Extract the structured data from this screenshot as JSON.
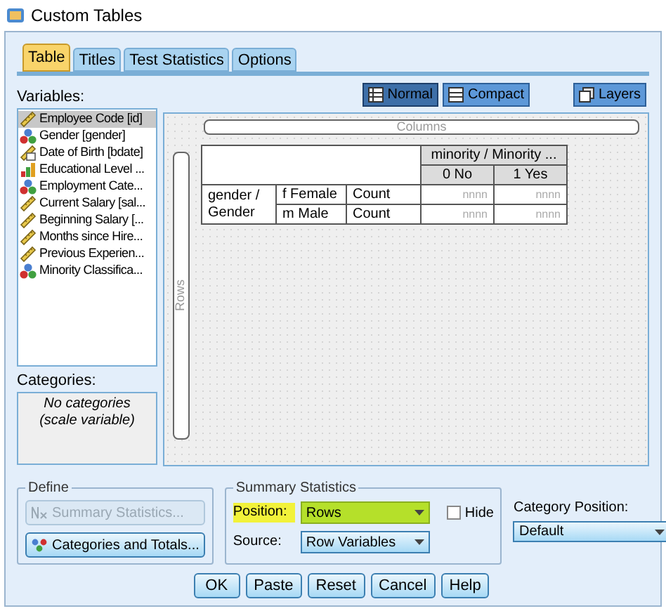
{
  "window": {
    "title": "Custom Tables"
  },
  "tabs": [
    {
      "label": "Table",
      "selected": true
    },
    {
      "label": "Titles",
      "selected": false
    },
    {
      "label": "Test Statistics",
      "selected": false
    },
    {
      "label": "Options",
      "selected": false
    }
  ],
  "view_buttons": [
    {
      "label": "Normal",
      "kind": "normal",
      "selected": true
    },
    {
      "label": "Compact",
      "kind": "compact",
      "selected": false
    }
  ],
  "layers_button": "Layers",
  "variables": {
    "label": "Variables:",
    "items": [
      {
        "name": "Employee Code [id]",
        "kind": "scale",
        "selected": true
      },
      {
        "name": "Gender [gender]",
        "kind": "nominal",
        "selected": false
      },
      {
        "name": "Date of Birth [bdate]",
        "kind": "date",
        "selected": false
      },
      {
        "name": "Educational Level ...",
        "kind": "ordinal",
        "selected": false
      },
      {
        "name": "Employment Cate...",
        "kind": "nominal",
        "selected": false
      },
      {
        "name": "Current Salary [sal...",
        "kind": "scale",
        "selected": false
      },
      {
        "name": "Beginning Salary [...",
        "kind": "scale",
        "selected": false
      },
      {
        "name": "Months since Hire...",
        "kind": "scale",
        "selected": false
      },
      {
        "name": "Previous Experien...",
        "kind": "scale",
        "selected": false
      },
      {
        "name": "Minority Classifica...",
        "kind": "nominal",
        "selected": false
      }
    ]
  },
  "categories": {
    "label": "Categories:",
    "text": "No categories (scale variable)"
  },
  "canvas": {
    "columns_label": "Columns",
    "rows_label": "Rows",
    "table": {
      "column_variable": "minority / Minority ...",
      "column_categories": [
        "0 No",
        "1 Yes"
      ],
      "row_variable": "gender / Gender",
      "rows": [
        {
          "category": "f Female",
          "statistic": "Count",
          "cells": [
            "nnnn",
            "nnnn"
          ]
        },
        {
          "category": "m Male",
          "statistic": "Count",
          "cells": [
            "nnnn",
            "nnnn"
          ]
        }
      ]
    }
  },
  "define": {
    "title": "Define",
    "buttons": [
      {
        "label": "Summary Statistics...",
        "kind": "summary",
        "disabled": true
      },
      {
        "label": "Categories and Totals...",
        "kind": "categories",
        "disabled": false
      }
    ]
  },
  "summary_statistics": {
    "title": "Summary Statistics",
    "fields": [
      {
        "label": "Position:",
        "value": "Rows",
        "highlighted": true
      },
      {
        "label": "Source:",
        "value": "Row Variables",
        "highlighted": false
      }
    ],
    "hide": {
      "label": "Hide",
      "checked": false
    }
  },
  "category_position": {
    "label": "Category Position:",
    "value": "Default"
  },
  "footer_buttons": [
    "OK",
    "Paste",
    "Reset",
    "Cancel",
    "Help"
  ]
}
